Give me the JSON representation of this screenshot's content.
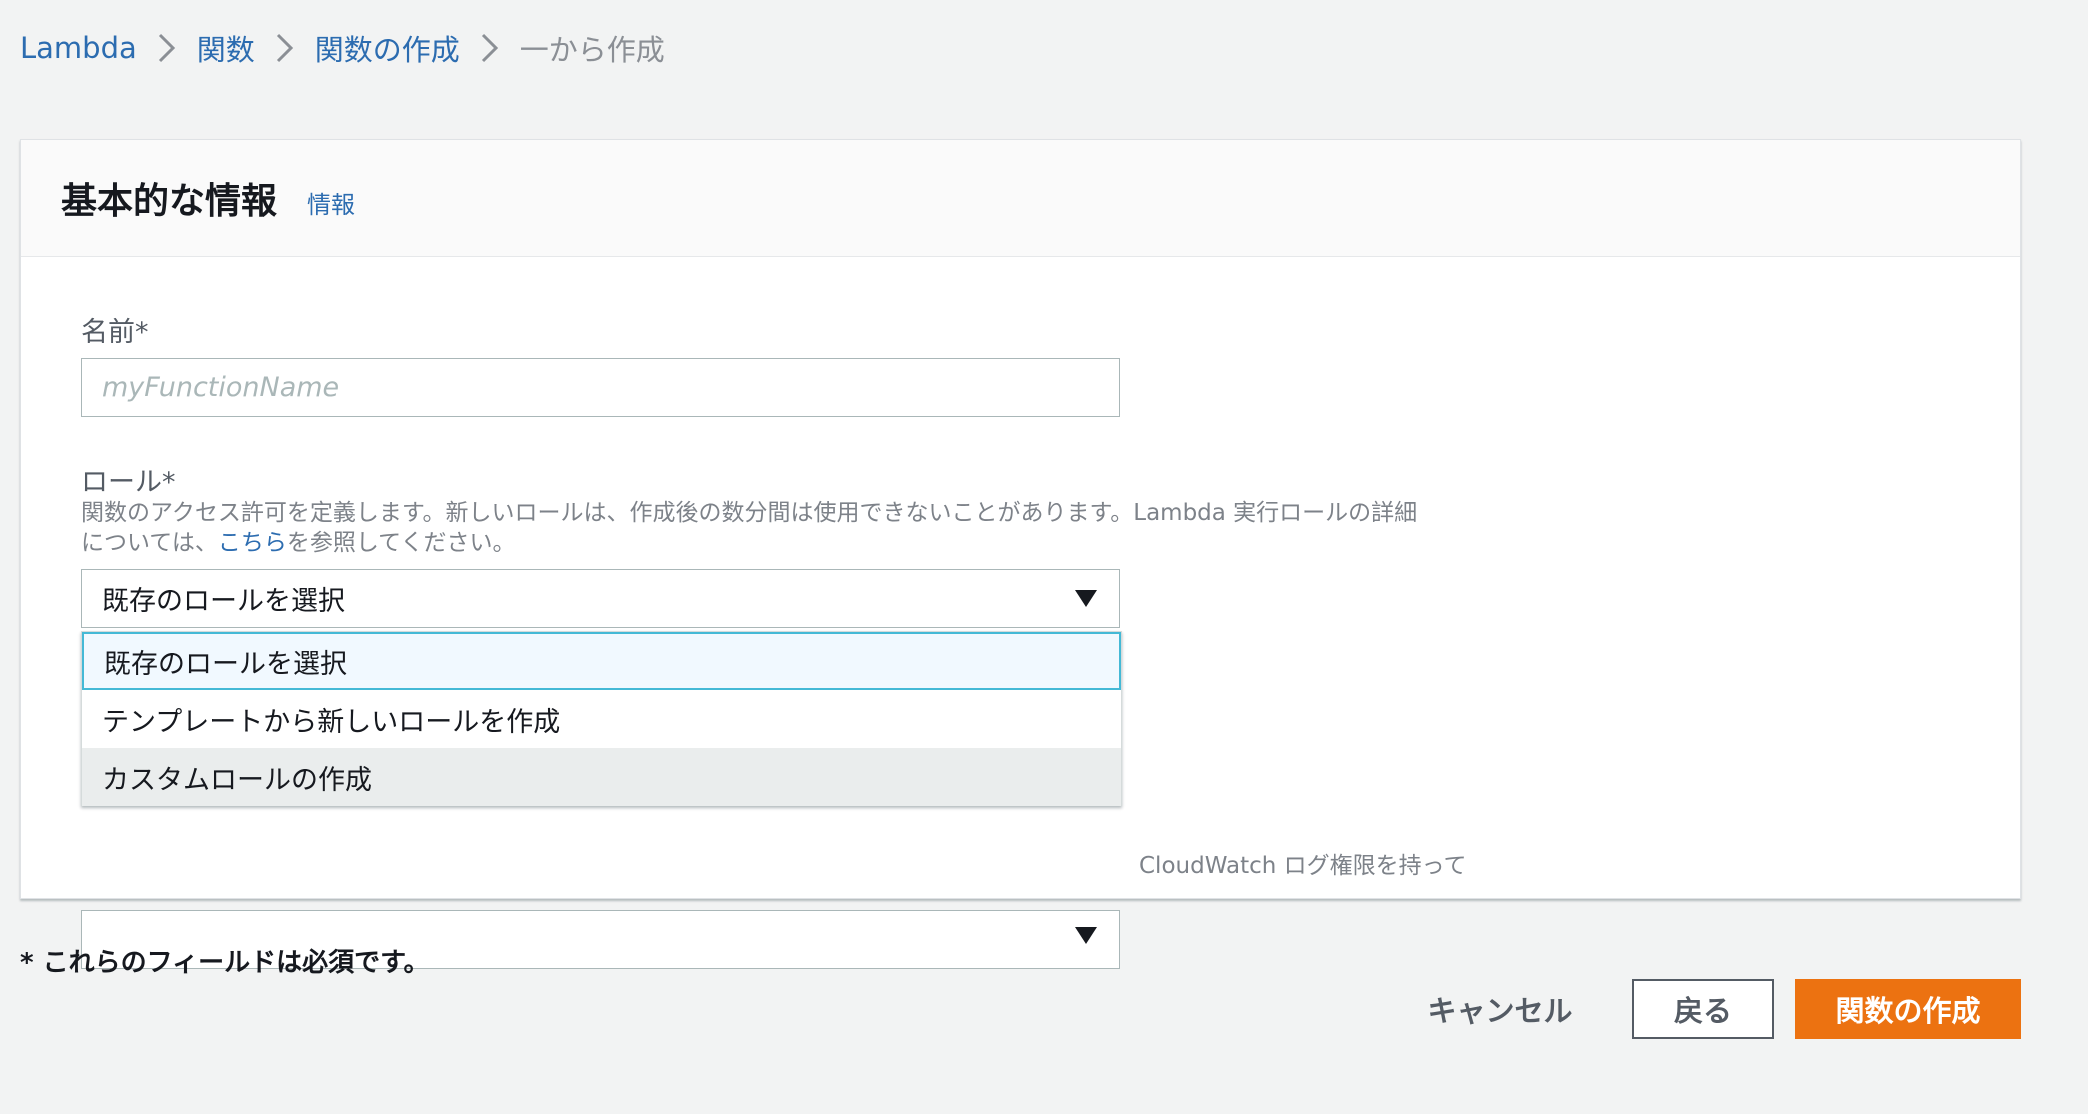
{
  "breadcrumb": {
    "items": [
      "Lambda",
      "関数",
      "関数の作成"
    ],
    "current": "一から作成"
  },
  "panel": {
    "title": "基本的な情報",
    "info_link": "情報"
  },
  "name_field": {
    "label": "名前*",
    "placeholder": "myFunctionName"
  },
  "role_field": {
    "label": "ロール*",
    "description_line1": "関数のアクセス許可を定義します。新しいロールは、作成後の数分間は使用できないことがあります。Lambda 実行ロールの詳細",
    "description_line2_before": "については、",
    "description_link": "こちら",
    "description_line2_after": "を参照してください。",
    "selected_value": "既存のロールを選択"
  },
  "role_dropdown": {
    "options": [
      "既存のロールを選択",
      "テンプレートから新しいロールを作成",
      "カスタムロールの作成"
    ]
  },
  "existing_role_field": {
    "description_tail": "CloudWatch ログ権限を持って"
  },
  "footer": {
    "required_note": "* これらのフィールドは必須です。",
    "cancel_label": "キャンセル",
    "back_label": "戻る",
    "create_label": "関数の作成"
  },
  "colors": {
    "link": "#2c6cb0",
    "primary_button": "#ec7211",
    "selected_border": "#44b9d6"
  }
}
